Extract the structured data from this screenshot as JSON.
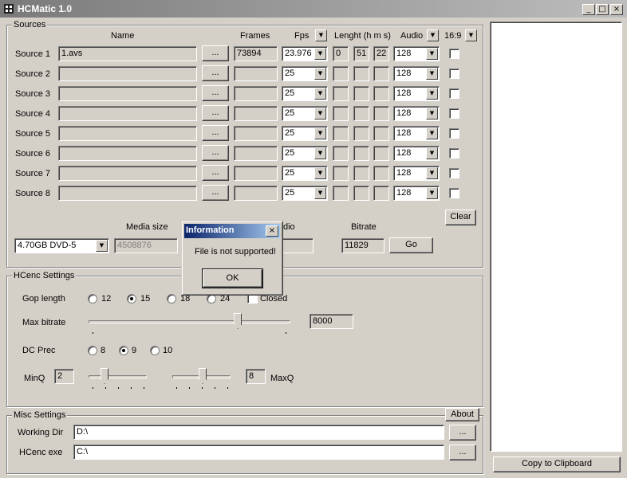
{
  "window": {
    "title": "HCMatic 1.0",
    "minimize": "_",
    "maximize": "□",
    "close": "×"
  },
  "sources": {
    "legend": "Sources",
    "headers": {
      "name": "Name",
      "frames": "Frames",
      "fps": "Fps",
      "length": "Lenght (h m s)",
      "audio": "Audio",
      "ratio": "16:9"
    },
    "browse_label": "...",
    "clear_label": "Clear",
    "rows": [
      {
        "label": "Source 1",
        "name": "1.avs",
        "frames": "73894",
        "fps": "23.976",
        "h": "0",
        "m": "51",
        "s": "22",
        "audio": "128"
      },
      {
        "label": "Source 2",
        "name": "",
        "frames": "",
        "fps": "25",
        "h": "",
        "m": "",
        "s": "",
        "audio": "128"
      },
      {
        "label": "Source 3",
        "name": "",
        "frames": "",
        "fps": "25",
        "h": "",
        "m": "",
        "s": "",
        "audio": "128"
      },
      {
        "label": "Source 4",
        "name": "",
        "frames": "",
        "fps": "25",
        "h": "",
        "m": "",
        "s": "",
        "audio": "128"
      },
      {
        "label": "Source 5",
        "name": "",
        "frames": "",
        "fps": "25",
        "h": "",
        "m": "",
        "s": "",
        "audio": "128"
      },
      {
        "label": "Source 6",
        "name": "",
        "frames": "",
        "fps": "25",
        "h": "",
        "m": "",
        "s": "",
        "audio": "128"
      },
      {
        "label": "Source 7",
        "name": "",
        "frames": "",
        "fps": "25",
        "h": "",
        "m": "",
        "s": "",
        "audio": "128"
      },
      {
        "label": "Source 8",
        "name": "",
        "frames": "",
        "fps": "25",
        "h": "",
        "m": "",
        "s": "",
        "audio": "128"
      }
    ],
    "media_size_label": "Media size",
    "media_select": "4.70GB DVD-5",
    "media_value": "4508876",
    "audio_partial_label": "dio",
    "bitrate_label": "Bitrate",
    "bitrate_value": "11829",
    "go_label": "Go"
  },
  "hcenc": {
    "legend": "HCenc Settings",
    "gop_label": "Gop length",
    "gop_options": [
      "12",
      "15",
      "18",
      "24"
    ],
    "gop_selected": "15",
    "closed_label": "Closed",
    "maxbitrate_label": "Max bitrate",
    "maxbitrate_value": "8000",
    "maxbitrate_level": 0.75,
    "dcprec_label": "DC Prec",
    "dcprec_options": [
      "8",
      "9",
      "10"
    ],
    "dcprec_selected": "9",
    "minq_label": "MinQ",
    "minq_value": "2",
    "maxq_label": "MaxQ",
    "maxq_value": "8"
  },
  "misc": {
    "legend": "Misc Settings",
    "about_label": "About",
    "working_dir_label": "Working Dir",
    "working_dir_value": "D:\\",
    "hcenc_exe_label": "HCenc exe",
    "hcenc_exe_value": "C:\\",
    "browse_label": "..."
  },
  "right_panel": {
    "copy_label": "Copy to Clipboard"
  },
  "dialog": {
    "title": "Information",
    "close": "×",
    "message": "File is not supported!",
    "ok_label": "OK"
  }
}
